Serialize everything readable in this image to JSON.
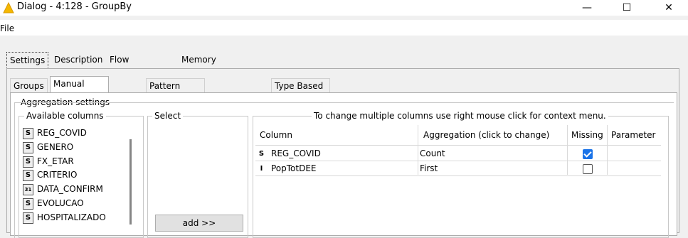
{
  "window": {
    "title": "Dialog - 4:128 - GroupBy",
    "minimize": "—",
    "maximize": "☐",
    "close": "✕"
  },
  "menu": {
    "file": "File"
  },
  "outer_tabs": [
    "Settings",
    "Description",
    "Flow Variables",
    "Memory Policy"
  ],
  "inner_tabs": [
    "Groups",
    "Manual Aggregation",
    "Pattern Based Aggregation",
    "Type Based Aggregation"
  ],
  "aggregation_settings_label": "Aggregation settings",
  "available_columns": {
    "label": "Available columns",
    "items": [
      {
        "type": "S",
        "name": "REG_COVID"
      },
      {
        "type": "S",
        "name": "GENERO"
      },
      {
        "type": "S",
        "name": "FX_ETAR"
      },
      {
        "type": "S",
        "name": "CRITERIO"
      },
      {
        "type": "31",
        "name": "DATA_CONFIRM"
      },
      {
        "type": "S",
        "name": "EVOLUCAO"
      },
      {
        "type": "S",
        "name": "HOSPITALIZADO"
      }
    ]
  },
  "select": {
    "label": "Select",
    "add_button": "add >>"
  },
  "aggregation_table": {
    "hint": "To change multiple columns use right mouse click for context menu.",
    "headers": [
      "Column",
      "Aggregation (click to change)",
      "Missing",
      "Parameter"
    ],
    "rows": [
      {
        "type": "S",
        "column": "REG_COVID",
        "aggregation": "Count",
        "missing": true
      },
      {
        "type": "I",
        "column": "PopTotDEE",
        "aggregation": "First",
        "missing": false
      }
    ]
  }
}
